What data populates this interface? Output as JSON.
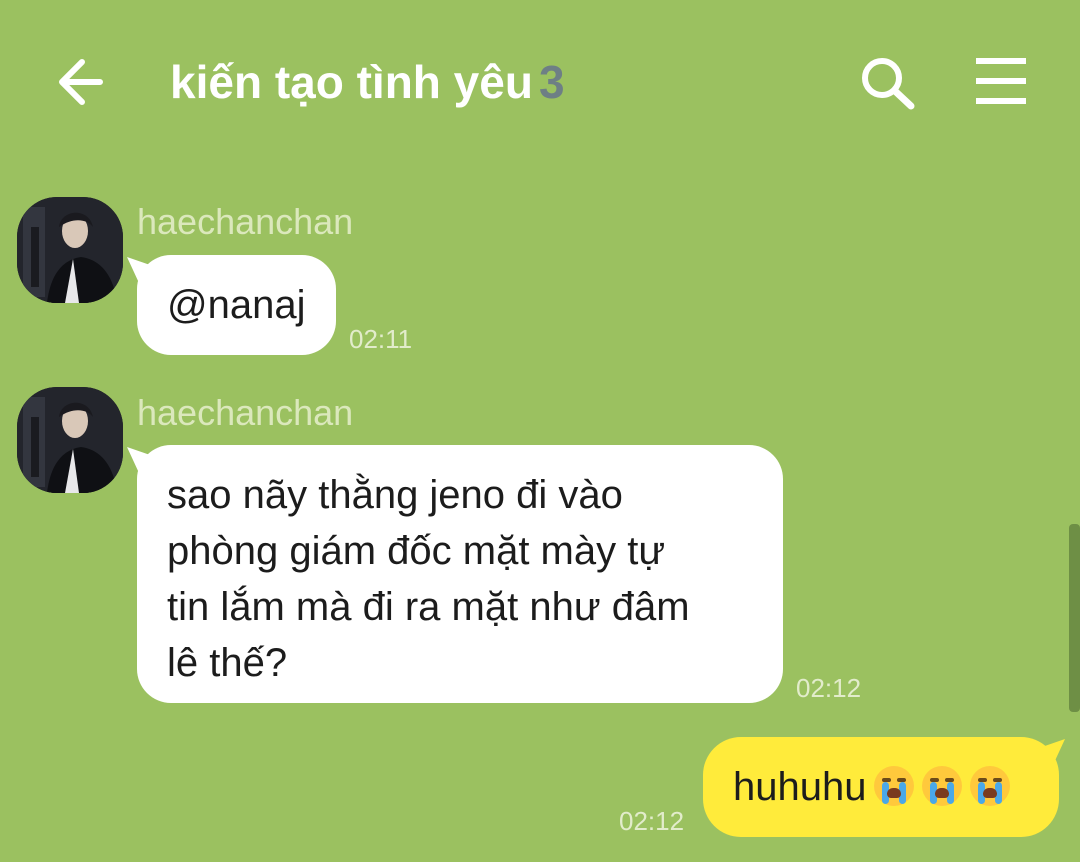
{
  "header": {
    "title": "kiến tạo tình yêu",
    "member_count": "3",
    "icons": {
      "back": "arrow-left-icon",
      "search": "search-icon",
      "menu": "hamburger-menu-icon"
    }
  },
  "messages": [
    {
      "sender": "haechanchan",
      "text": "@nanaj",
      "time": "02:11"
    },
    {
      "sender": "haechanchan",
      "text": "sao nãy thằng jeno đi vào\nphòng giám đốc mặt mày tự\ntin lắm mà đi ra mặt như đâm\nlê thế?",
      "time": "02:12"
    },
    {
      "sender": "",
      "text": "huhuhu",
      "emoji": "loudly-crying-face",
      "emoji_count": 3,
      "time": "02:12"
    }
  ],
  "colors": {
    "background": "#9bc160",
    "incoming_bubble": "#ffffff",
    "outgoing_bubble": "#ffeb3b",
    "member_count": "#6e7f85"
  }
}
